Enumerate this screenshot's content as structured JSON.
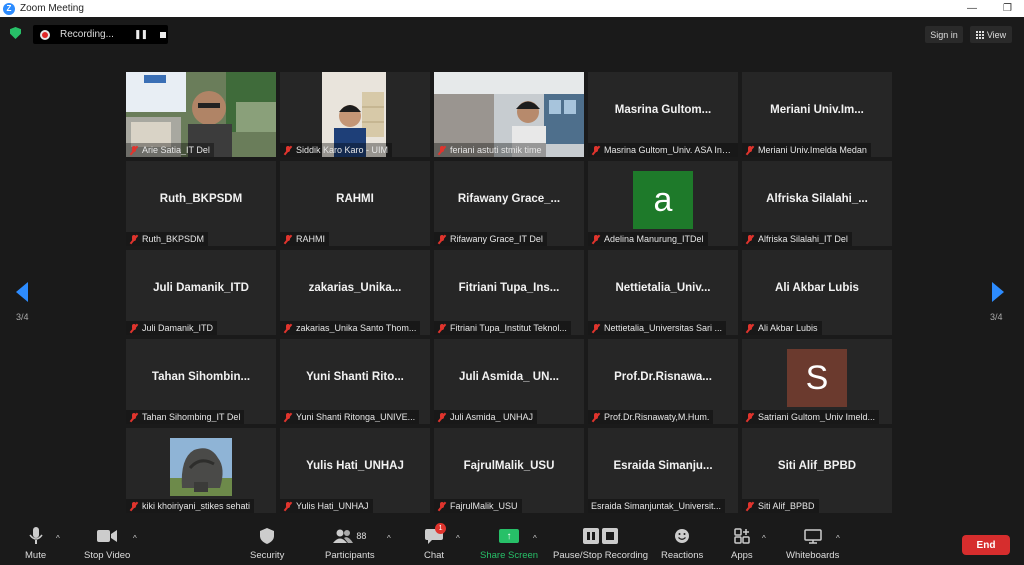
{
  "window": {
    "title": "Zoom Meeting"
  },
  "topbar": {
    "recording_label": "Recording...",
    "signin_label": "Sign in",
    "view_label": "View"
  },
  "pagination": {
    "left": "3/4",
    "right": "3/4"
  },
  "participants": [
    {
      "label": "Arie Satia_IT Del",
      "type": "video"
    },
    {
      "label": "Siddik Karo Karo - UIM",
      "type": "video"
    },
    {
      "label": "feriani astuti stmik time",
      "type": "video"
    },
    {
      "display_name": "Masrina  Gultom...",
      "label": "Masrina Gultom_Univ. ASA Ind..."
    },
    {
      "display_name": "Meriani  Univ.Im...",
      "label": "Meriani Univ.Imelda Medan"
    },
    {
      "display_name": "Ruth_BKPSDM",
      "label": "Ruth_BKPSDM"
    },
    {
      "display_name": "RAHMI",
      "label": "RAHMI"
    },
    {
      "display_name": "Rifawany  Grace_...",
      "label": "Rifawany Grace_IT Del"
    },
    {
      "avatar_letter": "a",
      "avatar_color": "#1e7a2a",
      "label": "Adelina Manurung_ITDel"
    },
    {
      "display_name": "Alfriska  Silalahi_...",
      "label": "Alfriska Silalahi_IT Del"
    },
    {
      "display_name": "Juli Damanik_ITD",
      "label": "Juli Damanik_ITD"
    },
    {
      "display_name": "zakarias_Unika...",
      "label": "zakarias_Unika Santo Thom..."
    },
    {
      "display_name": "Fitriani  Tupa_Ins...",
      "label": "Fitriani Tupa_Institut Teknol..."
    },
    {
      "display_name": "Nettietalia_Univ...",
      "label": "Nettietalia_Universitas Sari ..."
    },
    {
      "display_name": "Ali Akbar Lubis",
      "label": "Ali Akbar Lubis"
    },
    {
      "display_name": "Tahan  Sihombin...",
      "label": "Tahan Sihombing_IT Del"
    },
    {
      "display_name": "Yuni  Shanti  Rito...",
      "label": "Yuni Shanti Ritonga_UNIVE..."
    },
    {
      "display_name": "Juli  Asmida_  UN...",
      "label": "Juli Asmida_ UNHAJ"
    },
    {
      "display_name": "Prof.Dr.Risnawa...",
      "label": "Prof.Dr.Risnawaty,M.Hum."
    },
    {
      "avatar_letter": "S",
      "avatar_color": "#6b3a2e",
      "label": "Satriani Gultom_Univ Imeld..."
    },
    {
      "type": "photo",
      "label": "kiki khoiriyani_stikes sehati"
    },
    {
      "display_name": "Yulis Hati_UNHAJ",
      "label": "Yulis Hati_UNHAJ"
    },
    {
      "display_name": "FajrulMalik_USU",
      "label": "FajrulMalik_USU"
    },
    {
      "display_name": "Esraida  Simanju...",
      "label": "Esraida Simanjuntak_Universit...",
      "unmuted": true
    },
    {
      "display_name": "Siti Alif_BPBD",
      "label": "Siti Alif_BPBD"
    }
  ],
  "toolbar": {
    "mute": "Mute",
    "stop_video": "Stop Video",
    "security": "Security",
    "participants": "Participants",
    "participant_count": "88",
    "chat": "Chat",
    "chat_badge": "1",
    "share_screen": "Share Screen",
    "pause_stop_recording": "Pause/Stop Recording",
    "reactions": "Reactions",
    "apps": "Apps",
    "whiteboards": "Whiteboards",
    "end": "End"
  },
  "colors": {
    "accent": "#2d8cff",
    "share": "#27c068",
    "end": "#d62d2d",
    "muted": "#e0342d"
  }
}
